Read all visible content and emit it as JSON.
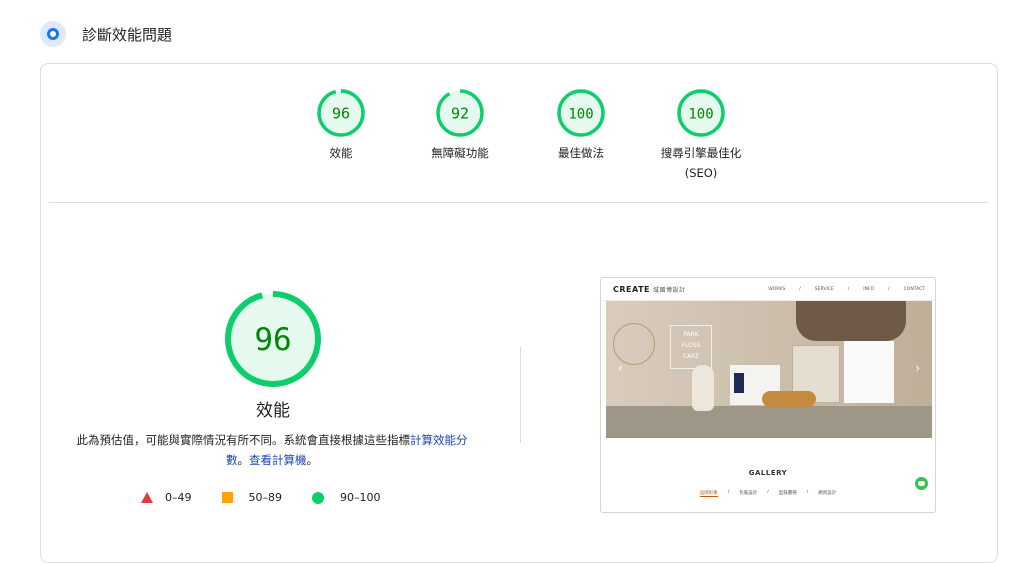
{
  "section": {
    "title": "診斷效能問題",
    "icon": "lighthouse-icon"
  },
  "gauges": [
    {
      "score": "96",
      "label_line1": "效能",
      "label_line2": "",
      "value": 96
    },
    {
      "score": "92",
      "label_line1": "無障礙功能",
      "label_line2": "",
      "value": 92
    },
    {
      "score": "100",
      "label_line1": "最佳做法",
      "label_line2": "",
      "value": 100
    },
    {
      "score": "100",
      "label_line1": "搜尋引擎最佳化",
      "label_line2": "(SEO)",
      "value": 100
    }
  ],
  "performance": {
    "score": "96",
    "value": 96,
    "label": "效能",
    "desc_text": "此為預估值，可能與實際情況有所不同。系統會直接根據這些指標",
    "desc_link1": "計算效能分數",
    "desc_sep": "。",
    "desc_link2": "查看計算機",
    "desc_end": "。"
  },
  "legend": [
    {
      "range": "0–49",
      "shape": "triangle",
      "color": "#e53935"
    },
    {
      "range": "50–89",
      "shape": "square",
      "color": "#ffa400"
    },
    {
      "range": "90–100",
      "shape": "circle",
      "color": "#0cce6b"
    }
  ],
  "colors": {
    "pass": "#0cce6b",
    "pass_fill": "#e6f9ee",
    "pass_text": "#008800",
    "link": "#1a47b8"
  },
  "screenshot": {
    "logo": "CREATE",
    "logo_sub": "域國博設計",
    "nav": [
      "WORKS",
      "/",
      "SERVICE",
      "/",
      "INFO",
      "/",
      "CONTACT"
    ],
    "hero_text_lines": [
      "PARK",
      "FLOSS",
      "CAKE"
    ],
    "gallery_title": "GALLERY",
    "gallery_tabs": [
      "品牌形象",
      "/",
      "包裝設計",
      "/",
      "型錄畫冊",
      "/",
      "網頁設計"
    ]
  }
}
